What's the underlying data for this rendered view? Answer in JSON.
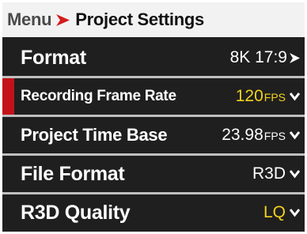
{
  "header": {
    "parent": "Menu",
    "current": "Project Settings",
    "separator_icon": "arrow-right-icon"
  },
  "colors": {
    "accent_red": "#c4121a",
    "highlight_yellow": "#f2d21b",
    "background": "#1f1f1f"
  },
  "menu": [
    {
      "label": "Format",
      "value": "8K 17:9",
      "unit": "",
      "value_color": "white",
      "chevron": "arrow-right-icon",
      "selected": false
    },
    {
      "label": "Recording Frame Rate",
      "value": "120",
      "unit": "FPS",
      "value_color": "yellow",
      "chevron": "chevron-down-icon",
      "selected": true
    },
    {
      "label": "Project Time Base",
      "value": "23.98",
      "unit": "FPS",
      "value_color": "white",
      "chevron": "chevron-down-icon",
      "selected": false
    },
    {
      "label": "File Format",
      "value": "R3D",
      "unit": "",
      "value_color": "white",
      "chevron": "chevron-down-icon",
      "selected": false
    },
    {
      "label": "R3D Quality",
      "value": "LQ",
      "unit": "",
      "value_color": "yellow",
      "chevron": "chevron-down-icon",
      "selected": false
    }
  ]
}
